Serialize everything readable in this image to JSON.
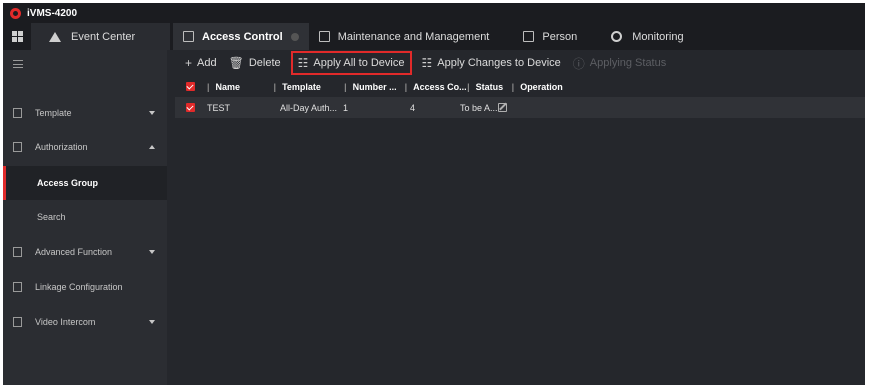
{
  "app": {
    "title": "iVMS-4200"
  },
  "tabs": [
    {
      "label": "Event Center",
      "icon": "bell-icon"
    },
    {
      "label": "Access Control",
      "icon": "access-control-icon",
      "active": true
    },
    {
      "label": "Maintenance and Management",
      "icon": "maintenance-icon"
    },
    {
      "label": "Person",
      "icon": "person-icon"
    },
    {
      "label": "Monitoring",
      "icon": "camera-icon"
    }
  ],
  "sidebar": {
    "items": [
      {
        "label": "Template",
        "icon": "template-icon",
        "expandable": true
      },
      {
        "label": "Authorization",
        "icon": "lock-icon",
        "expandable": true,
        "expanded": true
      },
      {
        "label": "Access Group",
        "selected": true
      },
      {
        "label": "Search"
      },
      {
        "label": "Advanced Function",
        "icon": "advanced-icon",
        "expandable": true
      },
      {
        "label": "Linkage Configuration",
        "icon": "linkage-icon"
      },
      {
        "label": "Video Intercom",
        "icon": "intercom-icon",
        "expandable": true
      }
    ]
  },
  "toolbar": {
    "add": "Add",
    "delete": "Delete",
    "apply_all": "Apply All to Device",
    "apply_changes": "Apply Changes to Device",
    "applying_status": "Applying Status"
  },
  "table": {
    "columns": [
      "Name",
      "Template",
      "Number ...",
      "Access Co...",
      "Status",
      "Operation"
    ],
    "rows": [
      {
        "name": "TEST",
        "template": "All-Day Auth...",
        "number": "1",
        "access_count": "4",
        "status": "To be A..."
      }
    ]
  },
  "colors": {
    "accent": "#e12a2a",
    "background": "#25272c",
    "sidebar": "#2b2d32"
  }
}
